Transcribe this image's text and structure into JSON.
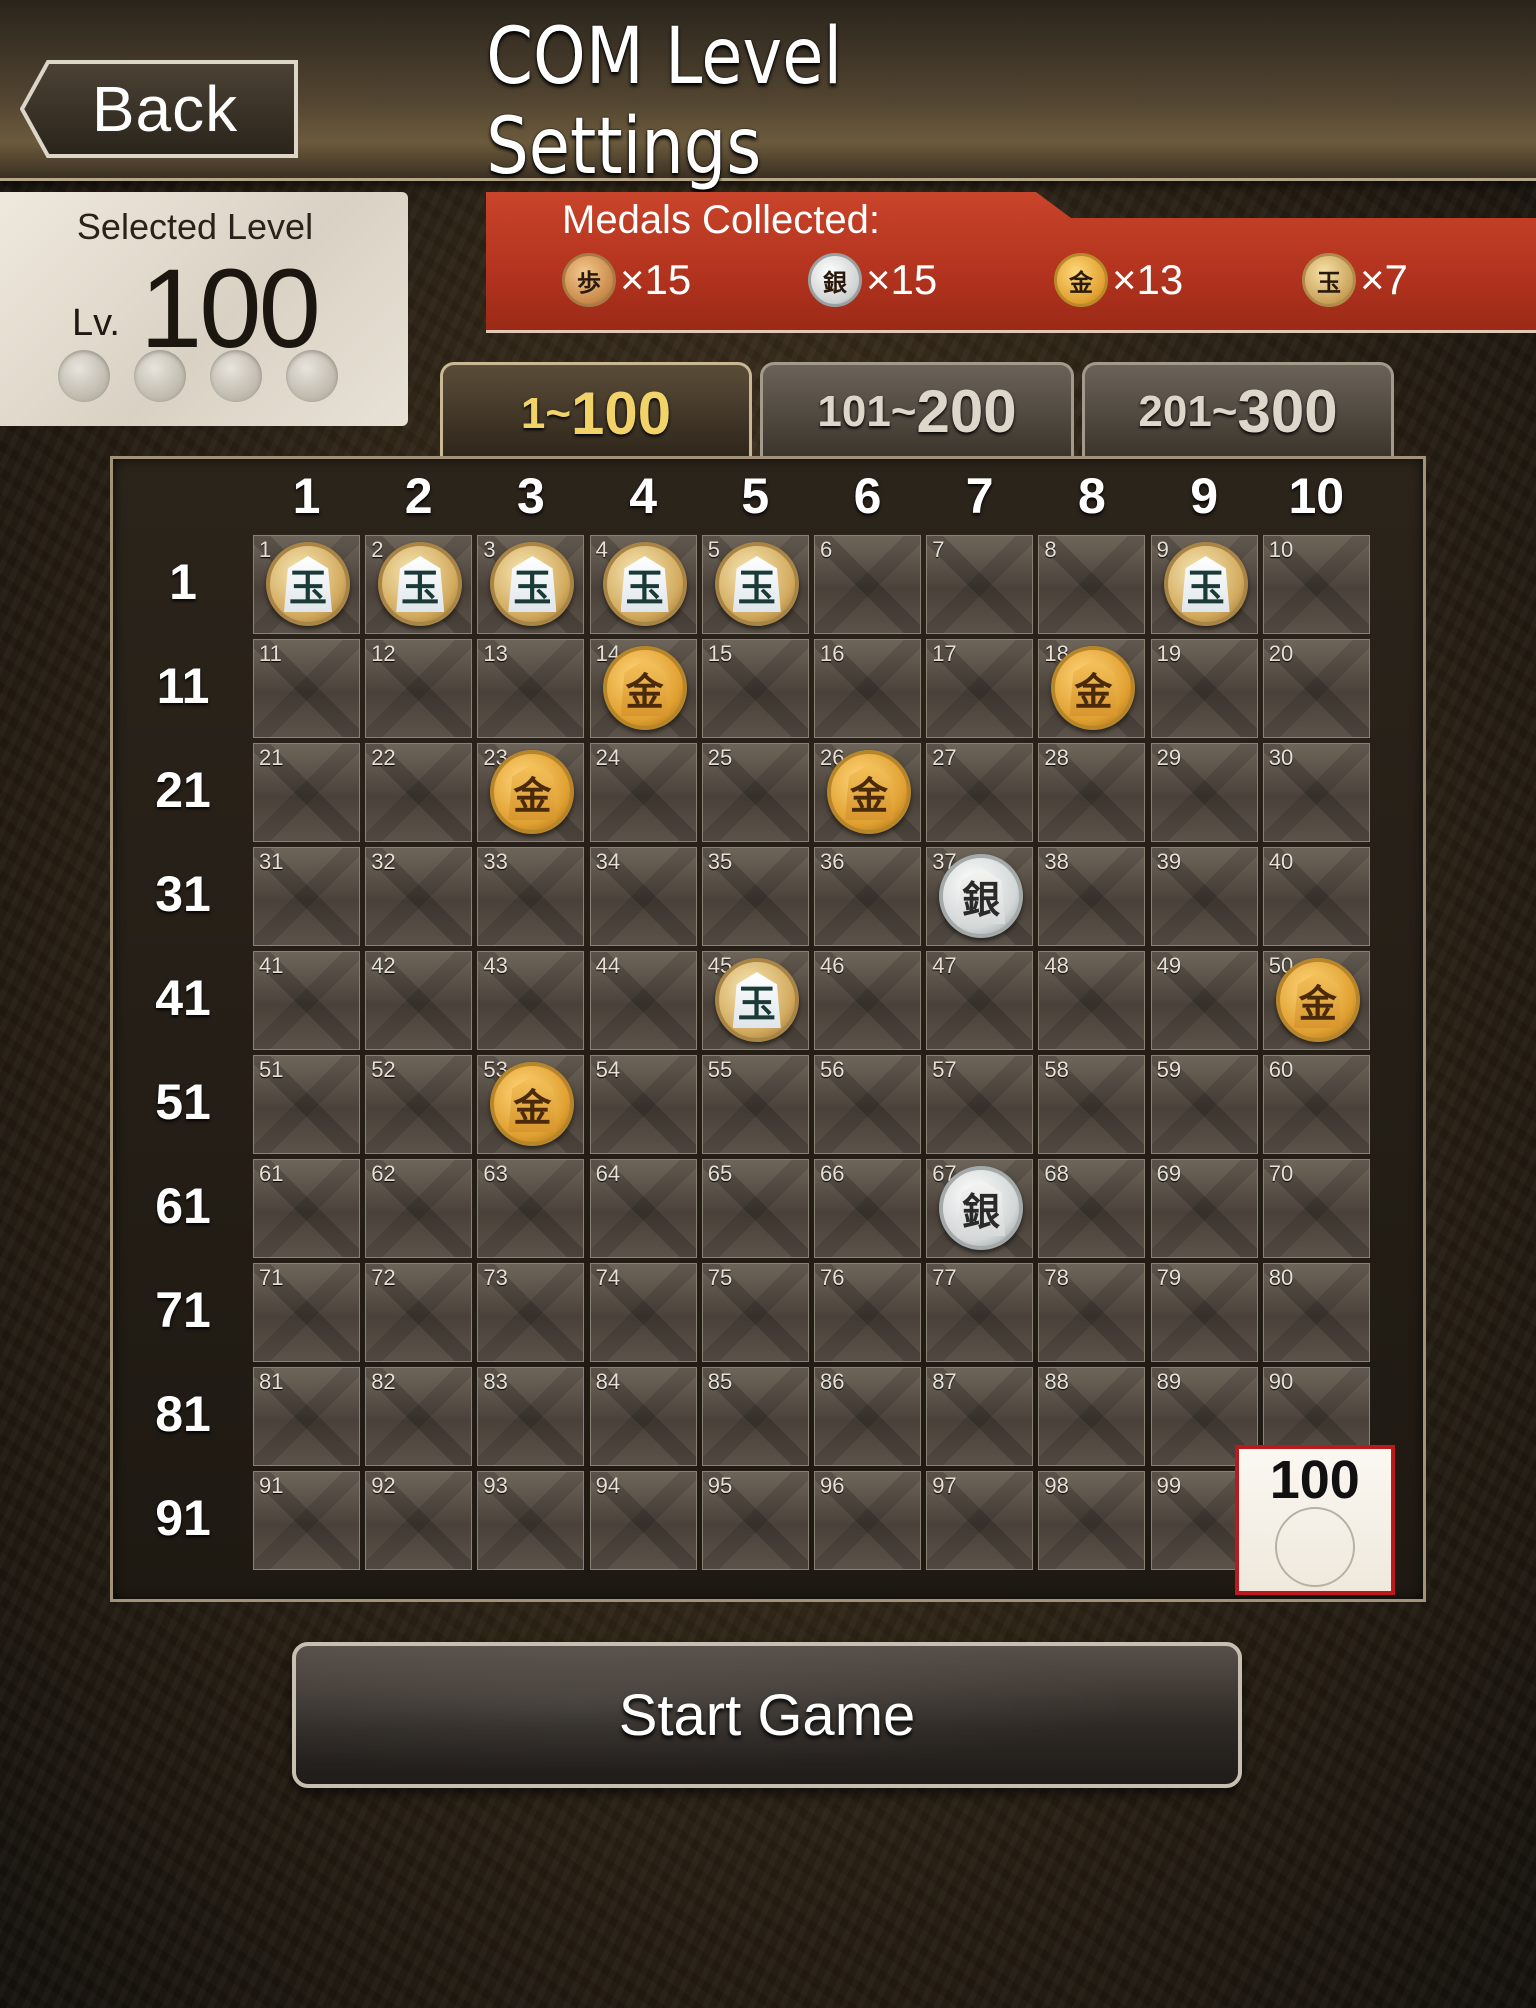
{
  "header": {
    "back_label": "Back",
    "title": "COM Level Settings"
  },
  "selected_level": {
    "label": "Selected Level",
    "prefix": "Lv.",
    "value": "100",
    "progress_dots_filled": 0,
    "progress_dots_total": 4
  },
  "medals": {
    "label": "Medals Collected:",
    "items": [
      {
        "type": "fu",
        "glyph": "歩",
        "count": "×15"
      },
      {
        "type": "gin",
        "glyph": "銀",
        "count": "×15"
      },
      {
        "type": "kin",
        "glyph": "金",
        "count": "×13"
      },
      {
        "type": "gyoku",
        "glyph": "玉",
        "count": "×7"
      }
    ]
  },
  "tabs": [
    {
      "prefix": "1",
      "sep": "~",
      "main": "100",
      "active": true
    },
    {
      "prefix": "101",
      "sep": "~",
      "main": "200",
      "active": false
    },
    {
      "prefix": "201",
      "sep": "~",
      "main": "300",
      "active": false
    }
  ],
  "grid": {
    "col_headers": [
      "1",
      "2",
      "3",
      "4",
      "5",
      "6",
      "7",
      "8",
      "9",
      "10"
    ],
    "row_headers": [
      "1",
      "11",
      "21",
      "31",
      "41",
      "51",
      "61",
      "71",
      "81",
      "91"
    ],
    "selected": 100,
    "medals": {
      "1": "gyoku",
      "2": "gyoku",
      "3": "gyoku",
      "4": "gyoku",
      "5": "gyoku",
      "9": "gyoku",
      "14": "kin",
      "18": "kin",
      "23": "kin",
      "26": "kin",
      "37": "gin",
      "45": "gyoku",
      "50": "kin",
      "53": "kin",
      "67": "gin"
    },
    "glyphs": {
      "gyoku": "玉",
      "kin": "金",
      "gin": "銀"
    }
  },
  "start_button": {
    "label": "Start Game"
  },
  "colors": {
    "banner_red": "#b2331e",
    "selected_border": "#b81a1e",
    "tab_active_text": "#f2d36a"
  }
}
